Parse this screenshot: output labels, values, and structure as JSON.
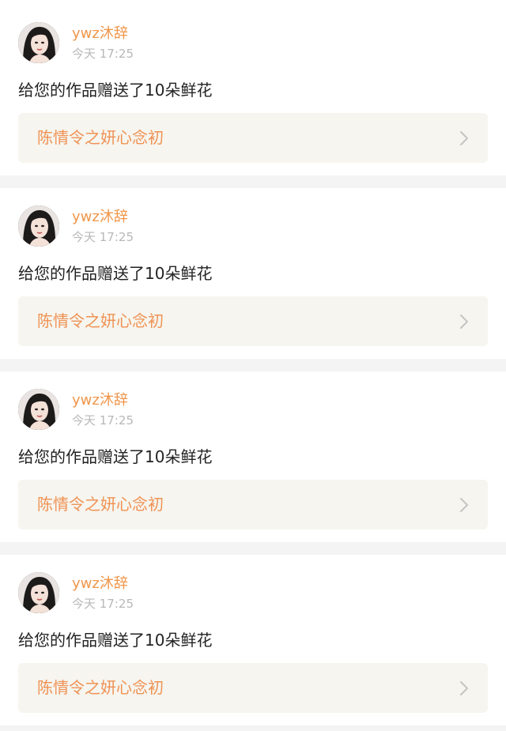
{
  "notifications": [
    {
      "username": "ywz沐辞",
      "time": "今天 17:25",
      "message": "给您的作品赠送了10朵鲜花",
      "work_title": "陈情令之妍心念初",
      "chevron_icon": "chevron-right-icon"
    },
    {
      "username": "ywz沐辞",
      "time": "今天 17:25",
      "message": "给您的作品赠送了10朵鲜花",
      "work_title": "陈情令之妍心念初",
      "chevron_icon": "chevron-right-icon"
    },
    {
      "username": "ywz沐辞",
      "time": "今天 17:25",
      "message": "给您的作品赠送了10朵鲜花",
      "work_title": "陈情令之妍心念初",
      "chevron_icon": "chevron-right-icon"
    },
    {
      "username": "ywz沐辞",
      "time": "今天 17:25",
      "message": "给您的作品赠送了10朵鲜花",
      "work_title": "陈情令之妍心念初",
      "chevron_icon": "chevron-right-icon"
    }
  ],
  "colors": {
    "username": "#f0964a",
    "work_title": "#ef9254",
    "link_background": "#f6f5ef",
    "page_background": "#f4f4f4"
  }
}
